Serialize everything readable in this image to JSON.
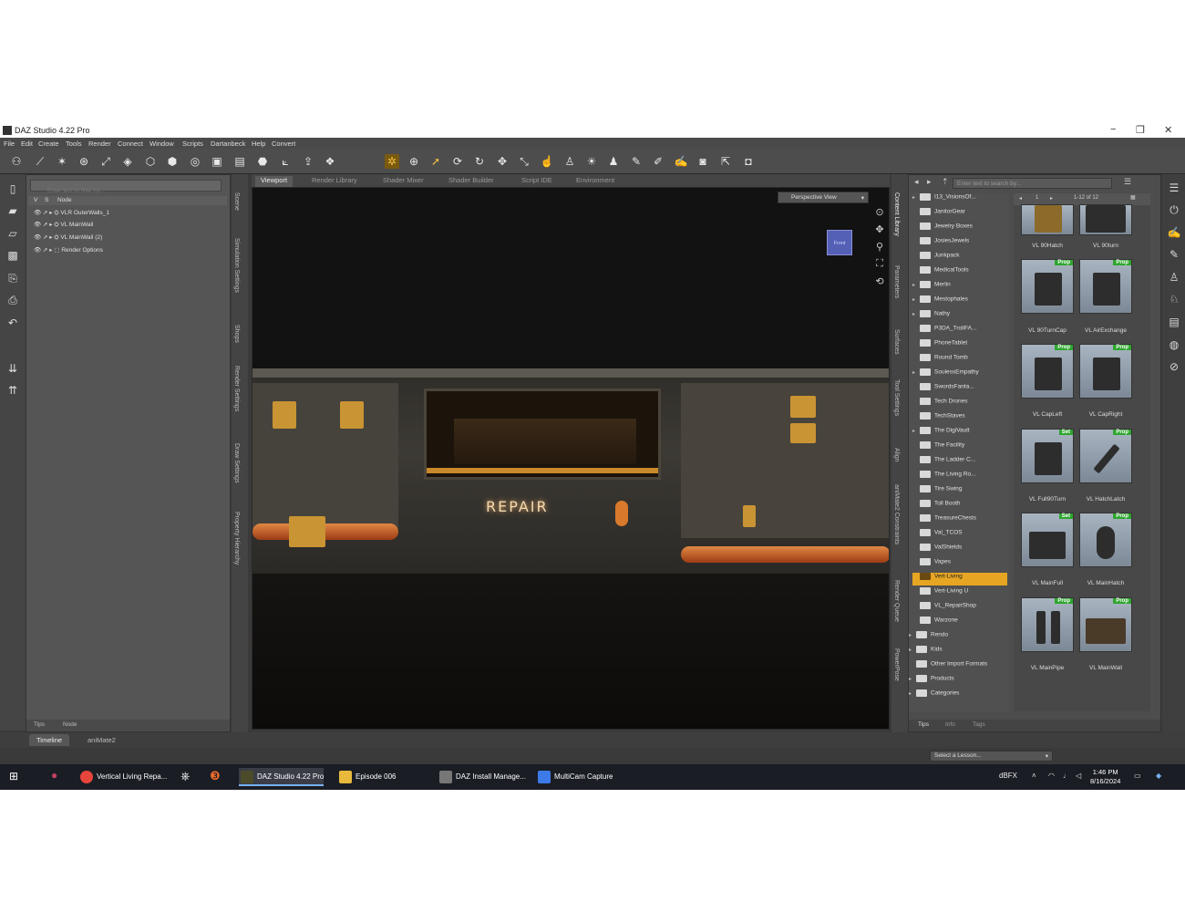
{
  "window": {
    "title": "DAZ Studio 4.22 Pro",
    "minimize": "−",
    "maximize": "❐",
    "close": "✕"
  },
  "menu": [
    "File",
    "Edit",
    "Create",
    "Tools",
    "Render",
    "Connect",
    "Window",
    "Scripts",
    "Dartanbeck",
    "Help",
    "Convert"
  ],
  "scene": {
    "filter_placeholder": "Enter text to filter by...",
    "col_v": "V",
    "col_s": "S",
    "col_node": "Node",
    "nodes": [
      "VLR OuterWalls_1",
      "VL MainWall",
      "VL MainWall (2)",
      "Render Options"
    ],
    "bottom_tabs": [
      "Tips",
      "Node"
    ]
  },
  "left_vtabs": [
    "Scene",
    "Simulation Settings",
    "Shops",
    "Render Settings",
    "Draw Settings",
    "Property Hierarchy"
  ],
  "viewport": {
    "tabs": [
      "Viewport",
      "Render Library",
      "Shader Mixer",
      "Shader Builder",
      "Script IDE",
      "Environment"
    ],
    "camera": "Perspective View",
    "navcube_label": "Front",
    "sign_text": "REPAIR"
  },
  "right_vtabs": [
    "Content Library",
    "Parameters",
    "Surfaces",
    "Tool Settings",
    "Align",
    "aniMate2 Constraints",
    "Render Queue",
    "PowerPose"
  ],
  "content_library": {
    "search_placeholder": "Enter text to search by...",
    "page": "1",
    "range": "1-12 of 12",
    "folders": [
      {
        "label": "I13_VisionsOf...",
        "tw": "▸"
      },
      {
        "label": "JanitorGear",
        "tw": ""
      },
      {
        "label": "Jewelry Boxes",
        "tw": ""
      },
      {
        "label": "JosiesJewels",
        "tw": ""
      },
      {
        "label": "Junkpack",
        "tw": ""
      },
      {
        "label": "MedicalTools",
        "tw": ""
      },
      {
        "label": "Merlin",
        "tw": "▸"
      },
      {
        "label": "Mestophales",
        "tw": "▸"
      },
      {
        "label": "Nathy",
        "tw": "▸"
      },
      {
        "label": "P3DA_TrollFA...",
        "tw": ""
      },
      {
        "label": "PhoneTablet",
        "tw": ""
      },
      {
        "label": "Round Tomb",
        "tw": ""
      },
      {
        "label": "SoulessEmpathy",
        "tw": "▸"
      },
      {
        "label": "SwordsFanta...",
        "tw": ""
      },
      {
        "label": "Tech Drones",
        "tw": ""
      },
      {
        "label": "TechStaves",
        "tw": ""
      },
      {
        "label": "The DigiVault",
        "tw": "▸"
      },
      {
        "label": "The Facility",
        "tw": ""
      },
      {
        "label": "The Ladder C...",
        "tw": ""
      },
      {
        "label": "The Living Ro...",
        "tw": ""
      },
      {
        "label": "Tire Swing",
        "tw": ""
      },
      {
        "label": "Toll Booth",
        "tw": ""
      },
      {
        "label": "TreasureChests",
        "tw": ""
      },
      {
        "label": "Val_TCOS",
        "tw": ""
      },
      {
        "label": "ValShields",
        "tw": ""
      },
      {
        "label": "Vapes",
        "tw": ""
      },
      {
        "label": "Vert-Living",
        "tw": "",
        "selected": true
      },
      {
        "label": "Vert-Living U",
        "tw": ""
      },
      {
        "label": "VL_RepairShop",
        "tw": ""
      },
      {
        "label": "Warzone",
        "tw": ""
      }
    ],
    "lower_folders": [
      "Rendo",
      "Kids",
      "Other Import Formats",
      "Products",
      "Categories"
    ],
    "items": [
      {
        "label": "VL 90Hatch",
        "badge": ""
      },
      {
        "label": "VL 90turn",
        "badge": ""
      },
      {
        "label": "VL 90TurnCap",
        "badge": "Prop"
      },
      {
        "label": "VL AirExchange",
        "badge": "Prop"
      },
      {
        "label": "VL CapLeft",
        "badge": "Prop"
      },
      {
        "label": "VL CapRight",
        "badge": "Prop"
      },
      {
        "label": "VL Full90Turn",
        "badge": "Set"
      },
      {
        "label": "VL HatchLatch",
        "badge": "Prop"
      },
      {
        "label": "VL MainFull",
        "badge": "Set"
      },
      {
        "label": "VL MainHatch",
        "badge": "Prop"
      },
      {
        "label": "VL MainPipe",
        "badge": "Prop"
      },
      {
        "label": "VL MainWall",
        "badge": "Prop"
      }
    ],
    "bottom_tabs": [
      "Tips",
      "Info",
      "Tags"
    ]
  },
  "bottom": {
    "tabs": [
      "Timeline",
      "aniMate2"
    ],
    "lesson": "Select a Lesson..."
  },
  "taskbar": {
    "items": [
      {
        "label": "Vertical Living Repa...",
        "color": "#e8453c"
      },
      {
        "label": "DAZ Studio 4.22 Pro",
        "color": "#4b4b2a",
        "active": true
      },
      {
        "label": "Episode 006",
        "color": "#e9b93c"
      },
      {
        "label": "DAZ Install Manage...",
        "color": "#777"
      },
      {
        "label": "MultiCam Capture",
        "color": "#3c7ae8"
      }
    ],
    "tray_label": "dBFX",
    "time": "1:46 PM",
    "date": "8/16/2024"
  },
  "colors": {
    "accent": "#e6a623",
    "badge": "#2fa62f",
    "workspace": "#3a3a3a"
  }
}
